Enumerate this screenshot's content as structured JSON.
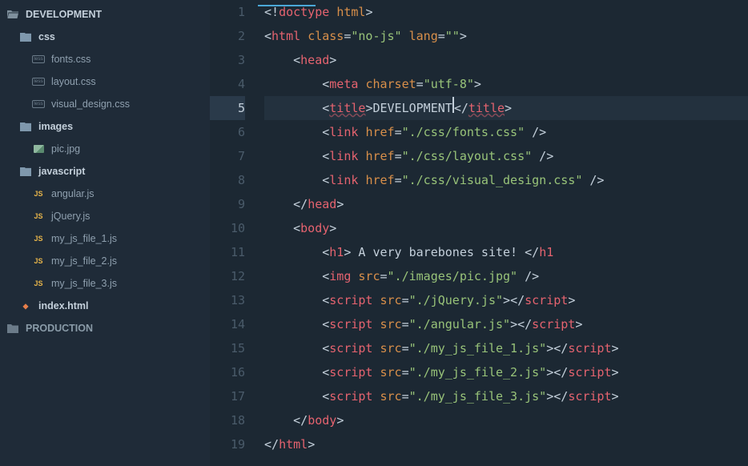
{
  "sidebar": {
    "root": {
      "label": "DEVELOPMENT",
      "folders": [
        {
          "label": "css",
          "files": [
            "fonts.css",
            "layout.css",
            "visual_design.css"
          ]
        },
        {
          "label": "images",
          "files": [
            "pic.jpg"
          ]
        },
        {
          "label": "javascript",
          "files": [
            "angular.js",
            "jQuery.js",
            "my_js_file_1.js",
            "my_js_file_2.js",
            "my_js_file_3.js"
          ]
        }
      ],
      "rootFiles": [
        "index.html"
      ]
    },
    "root2": {
      "label": "PRODUCTION"
    }
  },
  "editor": {
    "activeLine": 5,
    "lineCount": 19,
    "code": {
      "l1": {
        "bang": "<!",
        "kw": "doctype ",
        "doc": "html",
        "close": ">"
      },
      "l2": {
        "open": "<",
        "tag": "html ",
        "attr1": "class",
        "eq1": "=",
        "val1": "\"no-js\" ",
        "attr2": "lang",
        "eq2": "=",
        "val2": "\"\"",
        "close": ">"
      },
      "l3": {
        "indent": "    ",
        "open": "<",
        "tag": "head",
        "close": ">"
      },
      "l4": {
        "indent": "        ",
        "open": "<",
        "tag": "meta ",
        "attr": "charset",
        "eq": "=",
        "val": "\"utf-8\"",
        "close": ">"
      },
      "l5": {
        "indent": "        ",
        "open": "<",
        "tag": "title",
        "mid": ">",
        "text": "DEVELOPMENT",
        "copen": "</",
        "ctag": "title",
        "cend": ">"
      },
      "l6": {
        "indent": "        ",
        "open": "<",
        "tag": "link ",
        "attr": "href",
        "eq": "=",
        "val": "\"./css/fonts.css\"",
        "close": " />"
      },
      "l7": {
        "indent": "        ",
        "open": "<",
        "tag": "link ",
        "attr": "href",
        "eq": "=",
        "val": "\"./css/layout.css\"",
        "close": " />"
      },
      "l8": {
        "indent": "        ",
        "open": "<",
        "tag": "link ",
        "attr": "href",
        "eq": "=",
        "val": "\"./css/visual_design.css\"",
        "close": " />"
      },
      "l9": {
        "indent": "    ",
        "open": "</",
        "tag": "head",
        "close": ">"
      },
      "l10": {
        "indent": "    ",
        "open": "<",
        "tag": "body",
        "close": ">"
      },
      "l11": {
        "indent": "        ",
        "open": "<",
        "tag": "h1",
        "mid": ">",
        "text": " A very barebones site! ",
        "copen": "</",
        "ctag": "h1"
      },
      "l12": {
        "indent": "        ",
        "open": "<",
        "tag": "img ",
        "attr": "src",
        "eq": "=",
        "val": "\"./images/pic.jpg\"",
        "close": " />"
      },
      "l13": {
        "indent": "        ",
        "open": "<",
        "tag": "script ",
        "attr": "src",
        "eq": "=",
        "val": "\"./jQuery.js\"",
        "mid": ">",
        "copen": "</",
        "ctag": "script",
        "cend": ">"
      },
      "l14": {
        "indent": "        ",
        "open": "<",
        "tag": "script ",
        "attr": "src",
        "eq": "=",
        "val": "\"./angular.js\"",
        "mid": ">",
        "copen": "</",
        "ctag": "script",
        "cend": ">"
      },
      "l15": {
        "indent": "        ",
        "open": "<",
        "tag": "script ",
        "attr": "src",
        "eq": "=",
        "val": "\"./my_js_file_1.js\"",
        "mid": ">",
        "copen": "</",
        "ctag": "script",
        "cend": ">"
      },
      "l16": {
        "indent": "        ",
        "open": "<",
        "tag": "script ",
        "attr": "src",
        "eq": "=",
        "val": "\"./my_js_file_2.js\"",
        "mid": ">",
        "copen": "</",
        "ctag": "script",
        "cend": ">"
      },
      "l17": {
        "indent": "        ",
        "open": "<",
        "tag": "script ",
        "attr": "src",
        "eq": "=",
        "val": "\"./my_js_file_3.js\"",
        "mid": ">",
        "copen": "</",
        "ctag": "script",
        "cend": ">"
      },
      "l18": {
        "indent": "    ",
        "open": "</",
        "tag": "body",
        "close": ">"
      },
      "l19": {
        "open": "</",
        "tag": "html",
        "close": ">"
      }
    }
  }
}
